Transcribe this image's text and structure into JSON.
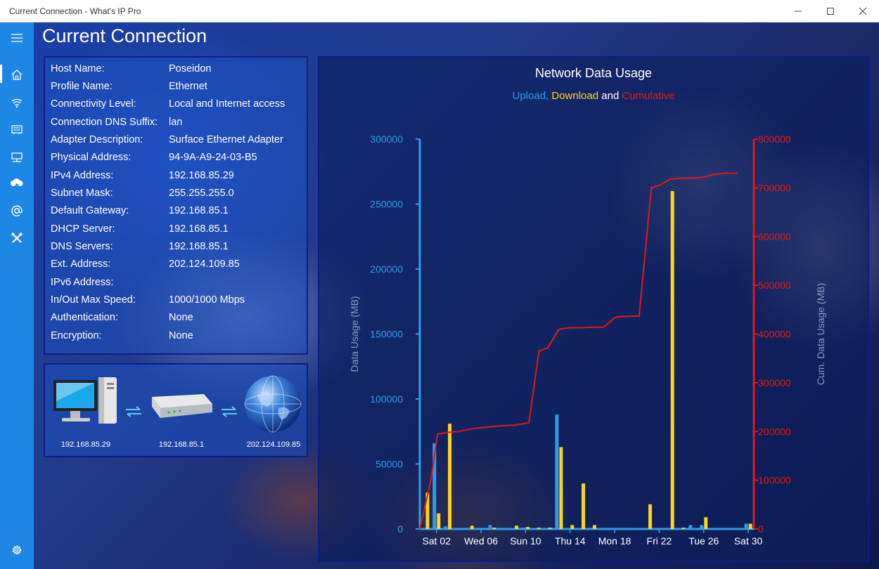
{
  "window": {
    "title": "Current Connection - What's IP Pro"
  },
  "page": {
    "title": "Current Connection"
  },
  "sidebar": {
    "items": [
      {
        "icon": "hamburger-icon"
      },
      {
        "icon": "home-icon"
      },
      {
        "icon": "wifi-icon"
      },
      {
        "icon": "network-card-icon"
      },
      {
        "icon": "monitor-network-icon"
      },
      {
        "icon": "cloud-upload-icon"
      },
      {
        "icon": "at-icon"
      },
      {
        "icon": "tools-icon"
      }
    ],
    "settings_icon": "gear-icon"
  },
  "connection": [
    {
      "key": "Host Name:",
      "value": "Poseidon"
    },
    {
      "key": "Profile Name:",
      "value": "Ethernet"
    },
    {
      "key": "Connectivity Level:",
      "value": "Local and Internet access"
    },
    {
      "key": "Connection DNS Suffix:",
      "value": "lan"
    },
    {
      "key": "Adapter Description:",
      "value": "Surface Ethernet Adapter"
    },
    {
      "key": "Physical Address:",
      "value": "94-9A-A9-24-03-B5"
    },
    {
      "key": "IPv4 Address:",
      "value": "192.168.85.29"
    },
    {
      "key": "Subnet Mask:",
      "value": "255.255.255.0"
    },
    {
      "key": "Default Gateway:",
      "value": "192.168.85.1"
    },
    {
      "key": "DHCP Server:",
      "value": "192.168.85.1"
    },
    {
      "key": "DNS Servers:",
      "value": "192.168.85.1"
    },
    {
      "key": "Ext. Address:",
      "value": "202.124.109.85"
    },
    {
      "key": "IPv6 Address:",
      "value": ""
    },
    {
      "key": "In/Out Max Speed:",
      "value": "1000/1000 Mbps"
    },
    {
      "key": "Authentication:",
      "value": "None"
    },
    {
      "key": "Encryption:",
      "value": "None"
    }
  ],
  "topology": {
    "computer_ip": "192.168.85.29",
    "router_ip": "192.168.85.1",
    "internet_ip": "202.124.109.85"
  },
  "colors": {
    "upload": "#2e9ce8",
    "download": "#ffd21c",
    "cumulative": "#e01818",
    "accent": "#1e87e5"
  },
  "chart_data": {
    "type": "bar",
    "title": "Network Data Usage",
    "subtitle": {
      "upload": "Upload,",
      "download": "Download",
      "and": "and",
      "cumulative": "Cumulative"
    },
    "ylabel": "Data Usage (MB)",
    "y2label": "Cum. Data Usage (MB)",
    "ylim": [
      0,
      300000
    ],
    "y2lim": [
      0,
      800000
    ],
    "yticks": [
      0,
      50000,
      100000,
      150000,
      200000,
      250000,
      300000
    ],
    "y2ticks": [
      0,
      100000,
      200000,
      300000,
      400000,
      500000,
      600000,
      700000,
      800000
    ],
    "xtick_labels": [
      "Sat 02",
      "Wed 06",
      "Sun 10",
      "Thu 14",
      "Mon 18",
      "Fri 22",
      "Tue 26",
      "Sat 30"
    ],
    "xtick_days": [
      2,
      6,
      10,
      14,
      18,
      22,
      26,
      30
    ],
    "xlim": [
      0.5,
      30.5
    ],
    "days": [
      1,
      2,
      3,
      4,
      5,
      6,
      7,
      8,
      9,
      10,
      11,
      12,
      13,
      14,
      15,
      16,
      17,
      18,
      19,
      20,
      21,
      22,
      23,
      24,
      25,
      26,
      27,
      28,
      29,
      30
    ],
    "series": [
      {
        "name": "Upload",
        "type": "bar",
        "values": [
          0,
          66000,
          2000,
          0,
          0,
          0,
          3000,
          0,
          0,
          1000,
          0,
          0,
          88000,
          0,
          0,
          0,
          0,
          0,
          0,
          0,
          0,
          0,
          0,
          0,
          3000,
          3000,
          0,
          0,
          0,
          4000
        ]
      },
      {
        "name": "Download",
        "type": "bar",
        "values": [
          28000,
          12000,
          81000,
          0,
          2500,
          0,
          1000,
          0,
          2500,
          1500,
          1000,
          1000,
          63000,
          3000,
          35000,
          3000,
          0,
          0,
          0,
          0,
          19000,
          0,
          260000,
          1000,
          0,
          9000,
          0,
          0,
          0,
          4000
        ]
      },
      {
        "name": "Cumulative",
        "type": "line",
        "values": [
          0,
          100000,
          195000,
          198000,
          200000,
          205000,
          208000,
          210000,
          212000,
          213000,
          218000,
          365000,
          372000,
          410000,
          413000,
          413000,
          414000,
          414000,
          435000,
          436000,
          437000,
          700000,
          705000,
          718000,
          720000,
          720000,
          722000,
          728000,
          730000,
          730000
        ],
        "x": [
          0.5,
          1.5,
          2.1,
          3,
          4,
          5,
          6,
          7,
          8,
          9,
          10.3,
          11.2,
          12,
          13,
          14,
          15,
          16,
          17,
          18.1,
          19,
          20.2,
          21.3,
          22,
          23,
          24,
          25,
          26,
          27,
          28,
          29
        ]
      }
    ]
  }
}
